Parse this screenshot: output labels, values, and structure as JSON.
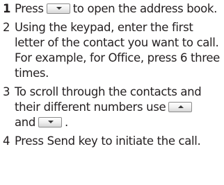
{
  "steps": [
    {
      "number": "1",
      "text_before": "Press",
      "icon": "down-arrow-key-icon",
      "text_after": "to open the address book."
    },
    {
      "number": "2",
      "text": "Using the keypad, enter the first letter of the contact you want to call. For example, for Office, press 6 three times."
    },
    {
      "number": "3",
      "text_before": "To scroll through the contacts and their different numbers use",
      "icon_1": "up-arrow-key-icon",
      "text_middle": "and",
      "icon_2": "down-arrow-key-icon",
      "text_after": "."
    },
    {
      "number": "4",
      "text": "Press Send key to initiate the call."
    }
  ]
}
